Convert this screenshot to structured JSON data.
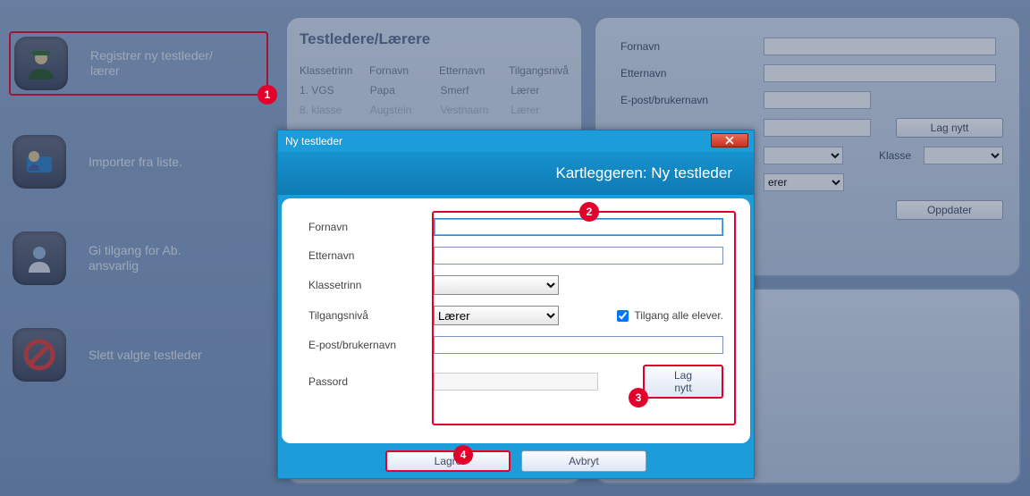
{
  "sidebar": {
    "items": [
      {
        "label": "Registrer ny testleder/\nlærer"
      },
      {
        "label": "Importer fra liste."
      },
      {
        "label": "Gi tilgang for Ab.\nansvarlig"
      },
      {
        "label": "Slett valgte testleder"
      }
    ]
  },
  "panel": {
    "title": "Testledere/Lærere",
    "columns": [
      "Klassetrinn",
      "Fornavn",
      "Etternavn",
      "Tilgangsnivå"
    ],
    "rows": [
      [
        "1. VGS",
        "Papa",
        "Smerf",
        "Lærer"
      ],
      [
        "8. klasse",
        "Augstein",
        "Vestnaarn",
        "Lærer"
      ]
    ]
  },
  "details": {
    "fields": {
      "fornavn": "Fornavn",
      "etternavn": "Etternavn",
      "epost": "E-post/brukernavn",
      "klasse": "Klasse"
    },
    "lag_nytt": "Lag nytt",
    "tilgang_selected": "erer",
    "oppdater": "Oppdater"
  },
  "modal": {
    "window_title": "Ny testleder",
    "header": "Kartleggeren: Ny testleder",
    "fields": {
      "fornavn": "Fornavn",
      "etternavn": "Etternavn",
      "klassetrinn": "Klassetrinn",
      "tilgang": "Tilgangsnivå",
      "tilgang_val": "Lærer",
      "tilgang_alle": "Tilgang alle elever.",
      "epost": "E-post/brukernavn",
      "passord": "Passord"
    },
    "lag_nytt": "Lag nytt",
    "lagre": "Lagre",
    "avbryt": "Avbryt"
  },
  "markers": {
    "m1": "1",
    "m2": "2",
    "m3": "3",
    "m4": "4"
  }
}
